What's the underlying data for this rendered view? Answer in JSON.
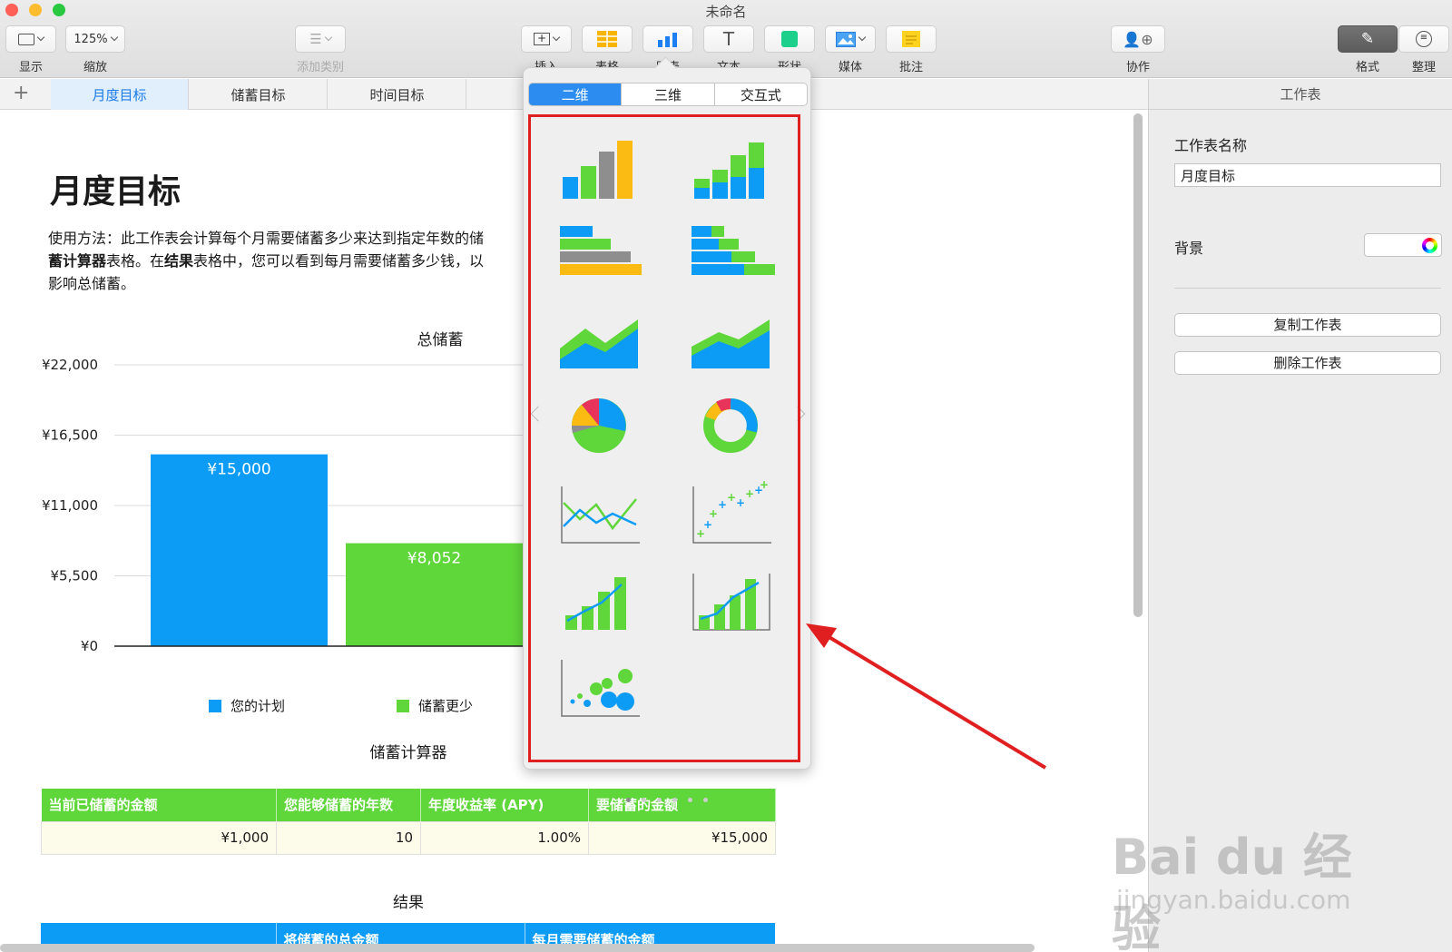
{
  "window": {
    "title": "未命名",
    "traffic_colors": [
      "#fe5f57",
      "#febc2e",
      "#28c840"
    ]
  },
  "toolbar": {
    "view_label": "显示",
    "zoom_value": "125%",
    "zoom_label": "缩放",
    "add_category_label": "添加类别",
    "insert_label": "插入",
    "table_label": "表格",
    "chart_label": "图表",
    "text_label": "文本",
    "shape_label": "形状",
    "media_label": "媒体",
    "comment_label": "批注",
    "collaborate_label": "协作",
    "format_label": "格式",
    "organize_label": "整理"
  },
  "tabs": [
    {
      "label": "月度目标",
      "selected": true
    },
    {
      "label": "储蓄目标",
      "selected": false
    },
    {
      "label": "时间目标",
      "selected": false
    }
  ],
  "document": {
    "title": "月度目标",
    "intro_line1": "使用方法：此工作表会计算每个月需要储蓄多少来达到指定年数的储",
    "intro_line2_bold": "蓄计算器",
    "intro_line2_a": "表格。在",
    "intro_line2_bold2": "结果",
    "intro_line2_b": "表格中，您可以看到每月需要储蓄多少钱，以",
    "intro_line3": "影响总储蓄。"
  },
  "chart_data": {
    "type": "bar",
    "title": "总储蓄",
    "categories": [
      "您的计划",
      "储蓄更少"
    ],
    "values": [
      15000,
      8052
    ],
    "value_labels": [
      "¥15,000",
      "¥8,052"
    ],
    "colors": [
      "#0d9cf5",
      "#5fd63a"
    ],
    "ylim": [
      0,
      22000
    ],
    "yticks": [
      0,
      5500,
      11000,
      16500,
      22000
    ],
    "ytick_labels": [
      "¥0",
      "¥5,500",
      "¥11,000",
      "¥16,500",
      "¥22,000"
    ],
    "legend": [
      {
        "name": "您的计划",
        "color": "#0d9cf5"
      },
      {
        "name": "储蓄更少",
        "color": "#5fd63a"
      }
    ],
    "grid": true
  },
  "calculator": {
    "title": "储蓄计算器",
    "header_color": "#5fd63a",
    "headers": [
      "当前已储蓄的金额",
      "您能够储蓄的年数",
      "年度收益率 (APY)",
      "要储蓄的金额"
    ],
    "row": [
      "¥1,000",
      "10",
      "1.00%",
      "¥15,000"
    ]
  },
  "results": {
    "title": "结果",
    "header_color": "#0d9cf5",
    "headers": [
      "",
      "将储蓄的总金额",
      "每月需要储蓄的金额"
    ]
  },
  "sidebar": {
    "header": "工作表",
    "name_label": "工作表名称",
    "name_value": "月度目标",
    "background_label": "背景",
    "duplicate_label": "复制工作表",
    "delete_label": "删除工作表"
  },
  "chart_popover": {
    "segments": [
      {
        "label": "二维",
        "selected": true
      },
      {
        "label": "三维",
        "selected": false
      },
      {
        "label": "交互式",
        "selected": false
      }
    ],
    "chart_types": [
      "column-chart-icon",
      "stacked-column-chart-icon",
      "bar-chart-icon",
      "stacked-bar-chart-icon",
      "area-chart-icon",
      "stacked-area-chart-icon",
      "pie-chart-icon",
      "donut-chart-icon",
      "line-chart-icon",
      "scatter-chart-icon",
      "mixed-chart-icon",
      "two-axis-chart-icon",
      "bubble-chart-icon"
    ],
    "page_count": 6,
    "current_page": 0,
    "highlight_color": "#e02020"
  },
  "watermark": {
    "logo": "Bai du 经验",
    "url": "jingyan.baidu.com"
  }
}
